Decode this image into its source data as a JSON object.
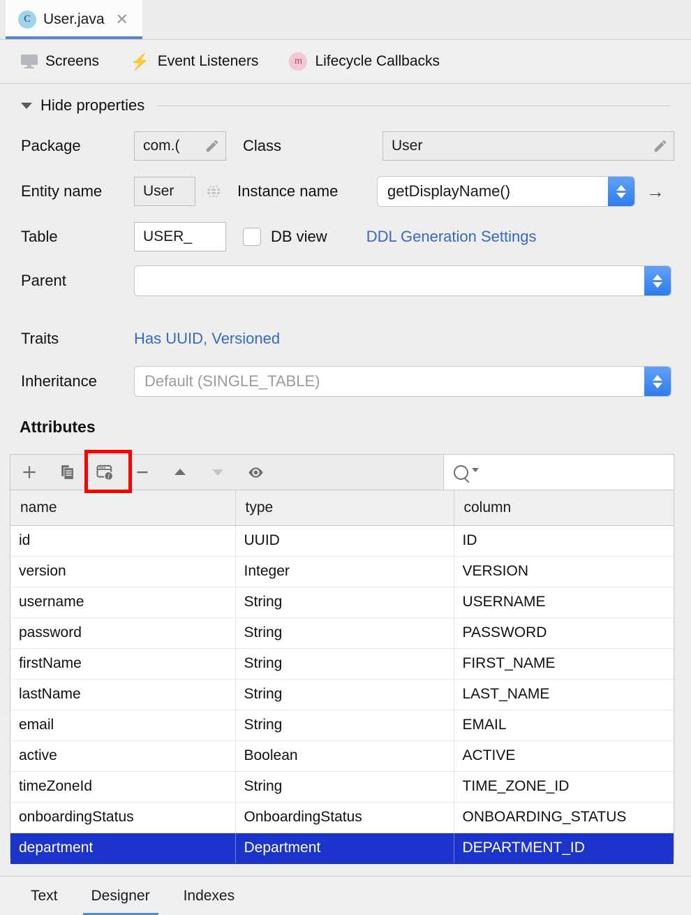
{
  "editor_tab": {
    "badge": "C",
    "badge_icon": "class-file-icon",
    "title": "User.java",
    "close_icon": "close-icon"
  },
  "subnav": {
    "items": [
      {
        "icon": "screen-icon",
        "label": "Screens"
      },
      {
        "icon": "lightning-bolt-icon",
        "label": "Event Listeners"
      },
      {
        "icon": "method-m-icon",
        "label": "Lifecycle Callbacks"
      }
    ]
  },
  "properties": {
    "toggle_label": "Hide properties",
    "toggle_icon": "caret-down-icon",
    "package": {
      "label": "Package",
      "value": "com.(",
      "edit_icon": "pencil-icon"
    },
    "class": {
      "label": "Class",
      "value": "User",
      "edit_icon": "pencil-icon"
    },
    "entity_name": {
      "label": "Entity name",
      "value": "User",
      "icon": "globe-icon"
    },
    "instance_name": {
      "label": "Instance name",
      "value": "getDisplayName()",
      "stepper_icon": "stepper-updown-icon",
      "jump_icon": "arrow-right-icon"
    },
    "table": {
      "label": "Table",
      "value": "USER_"
    },
    "db_view": {
      "label": "DB view",
      "checked": false
    },
    "ddl_link": "DDL Generation Settings",
    "parent": {
      "label": "Parent",
      "value": "",
      "stepper_icon": "stepper-updown-icon"
    },
    "traits": {
      "label": "Traits",
      "value": "Has UUID, Versioned"
    },
    "inheritance": {
      "label": "Inheritance",
      "placeholder": "Default (SINGLE_TABLE)",
      "stepper_icon": "stepper-updown-icon"
    }
  },
  "attributes": {
    "title": "Attributes",
    "toolbar": [
      {
        "name": "add-attribute-button",
        "icon": "plus-icon",
        "enabled": true,
        "highlighted": false
      },
      {
        "name": "duplicate-attribute-button",
        "icon": "copy-icon",
        "enabled": true,
        "highlighted": false
      },
      {
        "name": "new-field-button",
        "icon": "window-field-icon",
        "enabled": true,
        "highlighted": true
      },
      {
        "name": "remove-attribute-button",
        "icon": "minus-icon",
        "enabled": true,
        "highlighted": false
      },
      {
        "name": "move-up-button",
        "icon": "arrow-up-icon",
        "enabled": true,
        "highlighted": false
      },
      {
        "name": "move-down-button",
        "icon": "arrow-down-icon",
        "enabled": false,
        "highlighted": false
      },
      {
        "name": "toggle-visibility-button",
        "icon": "eye-icon",
        "enabled": true,
        "highlighted": false
      }
    ],
    "search": {
      "icon": "search-icon",
      "value": "",
      "placeholder": ""
    },
    "columns": [
      "name",
      "type",
      "column"
    ],
    "rows": [
      {
        "name": "id",
        "type": "UUID",
        "column": "ID",
        "selected": false
      },
      {
        "name": "version",
        "type": "Integer",
        "column": "VERSION",
        "selected": false
      },
      {
        "name": "username",
        "type": "String",
        "column": "USERNAME",
        "selected": false
      },
      {
        "name": "password",
        "type": "String",
        "column": "PASSWORD",
        "selected": false
      },
      {
        "name": "firstName",
        "type": "String",
        "column": "FIRST_NAME",
        "selected": false
      },
      {
        "name": "lastName",
        "type": "String",
        "column": "LAST_NAME",
        "selected": false
      },
      {
        "name": "email",
        "type": "String",
        "column": "EMAIL",
        "selected": false
      },
      {
        "name": "active",
        "type": "Boolean",
        "column": "ACTIVE",
        "selected": false
      },
      {
        "name": "timeZoneId",
        "type": "String",
        "column": "TIME_ZONE_ID",
        "selected": false
      },
      {
        "name": "onboardingStatus",
        "type": "OnboardingStatus",
        "column": "ONBOARDING_STATUS",
        "selected": false
      },
      {
        "name": "department",
        "type": "Department",
        "column": "DEPARTMENT_ID",
        "selected": true
      }
    ]
  },
  "bottom_tabs": {
    "items": [
      {
        "label": "Text",
        "active": false
      },
      {
        "label": "Designer",
        "active": true
      },
      {
        "label": "Indexes",
        "active": false
      }
    ]
  },
  "colors": {
    "accent_blue": "#5a87c9",
    "link_blue": "#3669c4",
    "selection_blue": "#1c34cc",
    "stepper_blue": "#2c7df0",
    "highlight_red": "#ff0000",
    "panel_bg": "#eeeeee"
  }
}
